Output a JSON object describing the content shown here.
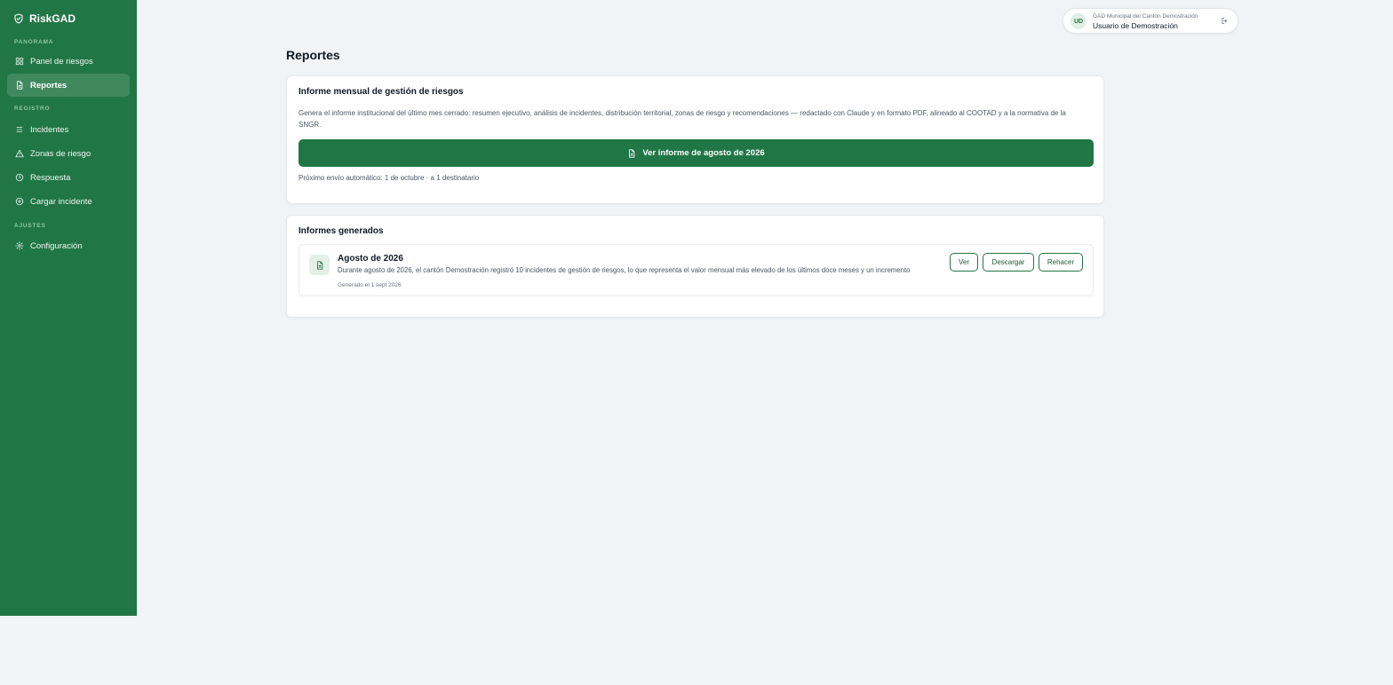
{
  "app": {
    "name": "RiskGAD"
  },
  "sidebar": {
    "sections": [
      {
        "label": "PANORAMA"
      },
      {
        "label": "REGISTRO"
      },
      {
        "label": "AJUSTES"
      }
    ],
    "items": [
      {
        "label": "Panel de riesgos",
        "icon": "grid-icon"
      },
      {
        "label": "Reportes",
        "icon": "document-icon",
        "active": true
      },
      {
        "label": "Incidentes",
        "icon": "list-icon"
      },
      {
        "label": "Zonas de riesgo",
        "icon": "warning-triangle-icon"
      },
      {
        "label": "Respuesta",
        "icon": "clock-icon"
      },
      {
        "label": "Cargar incidente",
        "icon": "plus-circle-icon"
      },
      {
        "label": "Configuración",
        "icon": "gear-icon"
      }
    ]
  },
  "user": {
    "initials": "UD",
    "organization": "GAD Municipal del Cantón Demostración",
    "name": "Usuario de Demostración"
  },
  "page": {
    "title": "Reportes"
  },
  "monthly_report": {
    "title": "Informe mensual de gestión de riesgos",
    "description": "Genera el informe institucional del último mes cerrado: resumen ejecutivo, análisis de incidentes, distribución territorial, zonas de riesgo y recomendaciones — redactado con Claude y en formato PDF, alineado al COOTAD y a la normativa de la SNGR.",
    "button_label": "Ver informe de agosto de 2026",
    "next_send": "Próximo envío automático: 1 de octubre · a 1 destinatario"
  },
  "generated": {
    "title": "Informes generados",
    "reports": [
      {
        "title": "Agosto de 2026",
        "summary": "Durante agosto de 2026, el cantón Demostración registró 10 incidentes de gestión de riesgos, lo que representa el valor mensual más elevado de los últimos doce meses y un incremento",
        "date": "Generado el 1 sept 2026",
        "actions": {
          "view": "Ver",
          "download": "Descargar",
          "redo": "Rehacer"
        }
      }
    ]
  },
  "colors": {
    "sidebar": "#217645",
    "accent": "#217645",
    "background": "#f1f3f6"
  }
}
